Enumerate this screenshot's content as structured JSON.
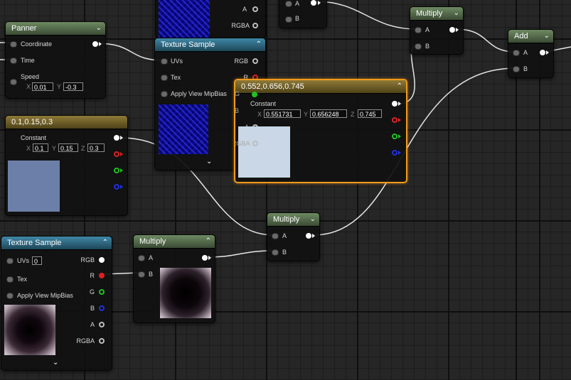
{
  "colors": {
    "header_green": "#566f4c",
    "header_blue": "#2c6d8a",
    "header_gold": "#6f5f28",
    "selection": "#f19a1a",
    "pin_red": "#e02020",
    "pin_green": "#20c020",
    "pin_blue": "#2030e0",
    "constant3_swatch": "#6c7fa8",
    "constant_sel_swatch": "#c9d7e6"
  },
  "icons": {
    "collapse": "chevron-down-icon",
    "advanced": "chevron-up-icon"
  },
  "panner": {
    "title": "Panner",
    "chevron": "⌄",
    "pins": {
      "coordinate": "Coordinate",
      "time": "Time",
      "speed": "Speed"
    },
    "speed_x_label": "X",
    "speed_x": "0.01",
    "speed_y_label": "Y",
    "speed_y": "-0.3"
  },
  "texsample_top": {
    "title": "Texture Sample",
    "chevron": "⌃",
    "inputs": {
      "uvs": "UVs",
      "tex": "Tex",
      "mip": "Apply View MipBias"
    },
    "outputs": {
      "rgb": "RGB",
      "r": "R",
      "a": "A",
      "rgba": "RGBA"
    },
    "expand": "⌄"
  },
  "partial_top": {
    "a_label": "A",
    "b_label": "B",
    "a_label2": "A",
    "rgba_label": "RGBA"
  },
  "multiply_top": {
    "title": "Multiply",
    "chevron": "⌄",
    "a": "A",
    "b": "B"
  },
  "add": {
    "title": "Add",
    "chevron": "⌄",
    "a": "A",
    "b": "B"
  },
  "constant3": {
    "title": "0.1,0.15,0.3",
    "label": "Constant",
    "x_label": "X",
    "x": "0.1",
    "y_label": "Y",
    "y": "0.15",
    "z_label": "Z",
    "z": "0.3"
  },
  "constant_sel": {
    "title": "0.552,0.656,0.745",
    "chevron": "⌃",
    "label": "Constant",
    "x_label": "X",
    "x": "0.551731",
    "y_label": "Y",
    "y": "0.656248",
    "z_label": "Z",
    "z": "0.745",
    "under_g": "G",
    "under_b": "B",
    "under_a": "A",
    "under_rgba": "RGBA"
  },
  "multiply_mid": {
    "title": "Multiply",
    "chevron": "⌄",
    "a": "A",
    "b": "B"
  },
  "texsample_bottom": {
    "title": "Texture Sample",
    "chevron": "⌃",
    "inputs": {
      "uvs": "UVs",
      "uvs_value": "0",
      "tex": "Tex",
      "mip": "Apply View MipBias"
    },
    "outputs": {
      "rgb": "RGB",
      "r": "R",
      "g": "G",
      "b": "B",
      "a": "A",
      "rgba": "RGBA"
    },
    "expand": "⌄"
  },
  "multiply_bottom": {
    "title": "Multiply",
    "chevron": "⌃",
    "a": "A",
    "b": "B"
  }
}
